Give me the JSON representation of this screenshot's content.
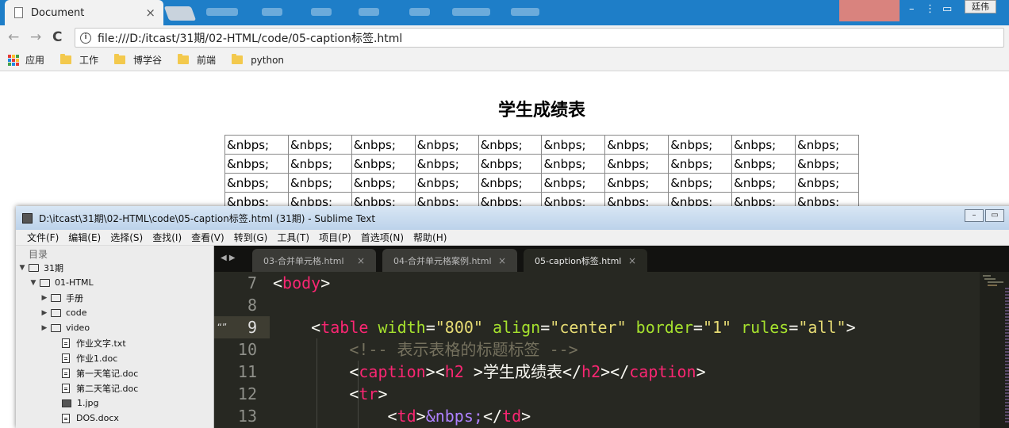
{
  "browser": {
    "tab_title": "Document",
    "tab_close": "×",
    "user_button": "廷伟",
    "nav": {
      "back": "←",
      "forward": "→",
      "reload": "C"
    },
    "url": "file:///D:/itcast/31期/02-HTML/code/05-caption标签.html",
    "bookmarks": [
      {
        "label": "应用"
      },
      {
        "label": "工作"
      },
      {
        "label": "博学谷"
      },
      {
        "label": "前端"
      },
      {
        "label": "python"
      }
    ]
  },
  "page": {
    "caption": "学生成绩表",
    "cell_text": "&nbps;",
    "rows": 4,
    "cols": 10
  },
  "editor": {
    "title": "D:\\itcast\\31期\\02-HTML\\code\\05-caption标签.html (31期) - Sublime Text",
    "menu": [
      "文件(F)",
      "编辑(E)",
      "选择(S)",
      "查找(I)",
      "查看(V)",
      "转到(G)",
      "工具(T)",
      "项目(P)",
      "首选项(N)",
      "帮助(H)"
    ],
    "sidebar_header": "目录",
    "tree": [
      {
        "label": "31期",
        "type": "folder",
        "expanded": true
      },
      {
        "label": "01-HTML",
        "type": "folder",
        "expanded": true
      },
      {
        "label": "手册",
        "type": "folder",
        "expanded": false
      },
      {
        "label": "code",
        "type": "folder",
        "expanded": false
      },
      {
        "label": "video",
        "type": "folder",
        "expanded": false
      },
      {
        "label": "作业文字.txt",
        "type": "file"
      },
      {
        "label": "作业1.doc",
        "type": "file"
      },
      {
        "label": "第一天笔记.doc",
        "type": "file"
      },
      {
        "label": "第二天笔记.doc",
        "type": "file"
      },
      {
        "label": "1.jpg",
        "type": "image"
      },
      {
        "label": "DOS.docx",
        "type": "file"
      }
    ],
    "tabs": [
      {
        "label": "03-合并单元格.html",
        "active": false
      },
      {
        "label": "04-合并单元格案例.html",
        "active": false
      },
      {
        "label": "05-caption标签.html",
        "active": true
      }
    ],
    "line_numbers": [
      "7",
      "8",
      "9",
      "10",
      "11",
      "12",
      "13"
    ],
    "fold_marker": "“”",
    "colors": {
      "tag": "#f92672",
      "attr": "#a6e22e",
      "string": "#e6db74",
      "comment": "#75715e",
      "background": "#272822"
    }
  }
}
